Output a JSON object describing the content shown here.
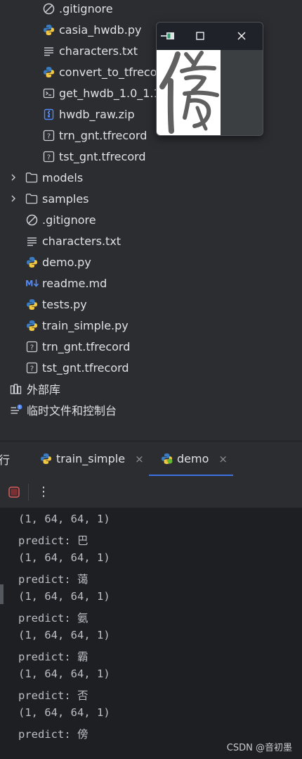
{
  "project_tree": {
    "sub_files": [
      {
        "label": ".gitignore",
        "icon": "gitignore-icon"
      },
      {
        "label": "casia_hwdb.py",
        "icon": "python-icon"
      },
      {
        "label": "characters.txt",
        "icon": "text-file-icon"
      },
      {
        "label": "convert_to_tfrecord",
        "icon": "python-icon"
      },
      {
        "label": "get_hwdb_1.0_1.1.sh",
        "icon": "shell-script-icon"
      },
      {
        "label": "hwdb_raw.zip",
        "icon": "zip-archive-icon"
      },
      {
        "label": "trn_gnt.tfrecord",
        "icon": "unknown-file-icon"
      },
      {
        "label": "tst_gnt.tfrecord",
        "icon": "unknown-file-icon"
      }
    ],
    "folders": [
      {
        "label": "models",
        "icon": "folder-icon"
      },
      {
        "label": "samples",
        "icon": "folder-icon"
      }
    ],
    "root_files": [
      {
        "label": ".gitignore",
        "icon": "gitignore-icon"
      },
      {
        "label": "characters.txt",
        "icon": "text-file-icon"
      },
      {
        "label": "demo.py",
        "icon": "python-icon"
      },
      {
        "label": "readme.md",
        "icon": "markdown-icon"
      },
      {
        "label": "tests.py",
        "icon": "python-icon"
      },
      {
        "label": "train_simple.py",
        "icon": "python-icon"
      },
      {
        "label": "trn_gnt.tfrecord",
        "icon": "unknown-file-icon"
      },
      {
        "label": "tst_gnt.tfrecord",
        "icon": "unknown-file-icon"
      }
    ],
    "external_libraries": "外部库",
    "scratches": "临时文件和控制台"
  },
  "image_window": {
    "glyph": "傍",
    "buttons": [
      "minimize-icon",
      "maximize-icon",
      "close-icon"
    ]
  },
  "run_panel": {
    "title_fragment": "行",
    "tabs": [
      {
        "label": "train_simple",
        "active": false
      },
      {
        "label": "demo",
        "active": true
      }
    ],
    "close_glyph": "×",
    "menu_glyph": "⋮"
  },
  "console": {
    "lines": [
      "(1, 64, 64, 1)",
      "predict: 巴",
      "(1, 64, 64, 1)",
      "predict: 蔼",
      "(1, 64, 64, 1)",
      "predict: 氨",
      "(1, 64, 64, 1)",
      "predict: 霸",
      "(1, 64, 64, 1)",
      "predict: 否",
      "(1, 64, 64, 1)",
      "predict: 傍"
    ]
  },
  "watermark": "CSDN @音初墨",
  "colors": {
    "background": "#2b2d30",
    "console_bg": "#1e1f22",
    "accent": "#3d6fe0",
    "stop": "#c94f4f"
  }
}
